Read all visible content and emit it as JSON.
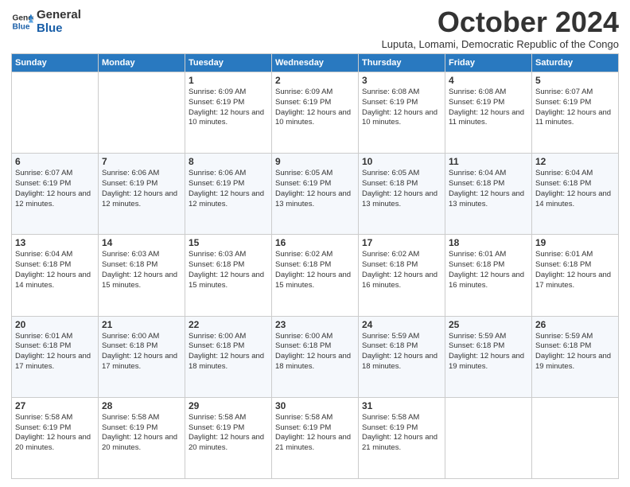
{
  "logo": {
    "line1": "General",
    "line2": "Blue"
  },
  "header": {
    "title": "October 2024",
    "subtitle": "Luputa, Lomami, Democratic Republic of the Congo"
  },
  "days_of_week": [
    "Sunday",
    "Monday",
    "Tuesday",
    "Wednesday",
    "Thursday",
    "Friday",
    "Saturday"
  ],
  "weeks": [
    [
      {
        "day": "",
        "info": ""
      },
      {
        "day": "",
        "info": ""
      },
      {
        "day": "1",
        "info": "Sunrise: 6:09 AM\nSunset: 6:19 PM\nDaylight: 12 hours\nand 10 minutes."
      },
      {
        "day": "2",
        "info": "Sunrise: 6:09 AM\nSunset: 6:19 PM\nDaylight: 12 hours\nand 10 minutes."
      },
      {
        "day": "3",
        "info": "Sunrise: 6:08 AM\nSunset: 6:19 PM\nDaylight: 12 hours\nand 10 minutes."
      },
      {
        "day": "4",
        "info": "Sunrise: 6:08 AM\nSunset: 6:19 PM\nDaylight: 12 hours\nand 11 minutes."
      },
      {
        "day": "5",
        "info": "Sunrise: 6:07 AM\nSunset: 6:19 PM\nDaylight: 12 hours\nand 11 minutes."
      }
    ],
    [
      {
        "day": "6",
        "info": "Sunrise: 6:07 AM\nSunset: 6:19 PM\nDaylight: 12 hours\nand 12 minutes."
      },
      {
        "day": "7",
        "info": "Sunrise: 6:06 AM\nSunset: 6:19 PM\nDaylight: 12 hours\nand 12 minutes."
      },
      {
        "day": "8",
        "info": "Sunrise: 6:06 AM\nSunset: 6:19 PM\nDaylight: 12 hours\nand 12 minutes."
      },
      {
        "day": "9",
        "info": "Sunrise: 6:05 AM\nSunset: 6:19 PM\nDaylight: 12 hours\nand 13 minutes."
      },
      {
        "day": "10",
        "info": "Sunrise: 6:05 AM\nSunset: 6:18 PM\nDaylight: 12 hours\nand 13 minutes."
      },
      {
        "day": "11",
        "info": "Sunrise: 6:04 AM\nSunset: 6:18 PM\nDaylight: 12 hours\nand 13 minutes."
      },
      {
        "day": "12",
        "info": "Sunrise: 6:04 AM\nSunset: 6:18 PM\nDaylight: 12 hours\nand 14 minutes."
      }
    ],
    [
      {
        "day": "13",
        "info": "Sunrise: 6:04 AM\nSunset: 6:18 PM\nDaylight: 12 hours\nand 14 minutes."
      },
      {
        "day": "14",
        "info": "Sunrise: 6:03 AM\nSunset: 6:18 PM\nDaylight: 12 hours\nand 15 minutes."
      },
      {
        "day": "15",
        "info": "Sunrise: 6:03 AM\nSunset: 6:18 PM\nDaylight: 12 hours\nand 15 minutes."
      },
      {
        "day": "16",
        "info": "Sunrise: 6:02 AM\nSunset: 6:18 PM\nDaylight: 12 hours\nand 15 minutes."
      },
      {
        "day": "17",
        "info": "Sunrise: 6:02 AM\nSunset: 6:18 PM\nDaylight: 12 hours\nand 16 minutes."
      },
      {
        "day": "18",
        "info": "Sunrise: 6:01 AM\nSunset: 6:18 PM\nDaylight: 12 hours\nand 16 minutes."
      },
      {
        "day": "19",
        "info": "Sunrise: 6:01 AM\nSunset: 6:18 PM\nDaylight: 12 hours\nand 17 minutes."
      }
    ],
    [
      {
        "day": "20",
        "info": "Sunrise: 6:01 AM\nSunset: 6:18 PM\nDaylight: 12 hours\nand 17 minutes."
      },
      {
        "day": "21",
        "info": "Sunrise: 6:00 AM\nSunset: 6:18 PM\nDaylight: 12 hours\nand 17 minutes."
      },
      {
        "day": "22",
        "info": "Sunrise: 6:00 AM\nSunset: 6:18 PM\nDaylight: 12 hours\nand 18 minutes."
      },
      {
        "day": "23",
        "info": "Sunrise: 6:00 AM\nSunset: 6:18 PM\nDaylight: 12 hours\nand 18 minutes."
      },
      {
        "day": "24",
        "info": "Sunrise: 5:59 AM\nSunset: 6:18 PM\nDaylight: 12 hours\nand 18 minutes."
      },
      {
        "day": "25",
        "info": "Sunrise: 5:59 AM\nSunset: 6:18 PM\nDaylight: 12 hours\nand 19 minutes."
      },
      {
        "day": "26",
        "info": "Sunrise: 5:59 AM\nSunset: 6:18 PM\nDaylight: 12 hours\nand 19 minutes."
      }
    ],
    [
      {
        "day": "27",
        "info": "Sunrise: 5:58 AM\nSunset: 6:19 PM\nDaylight: 12 hours\nand 20 minutes."
      },
      {
        "day": "28",
        "info": "Sunrise: 5:58 AM\nSunset: 6:19 PM\nDaylight: 12 hours\nand 20 minutes."
      },
      {
        "day": "29",
        "info": "Sunrise: 5:58 AM\nSunset: 6:19 PM\nDaylight: 12 hours\nand 20 minutes."
      },
      {
        "day": "30",
        "info": "Sunrise: 5:58 AM\nSunset: 6:19 PM\nDaylight: 12 hours\nand 21 minutes."
      },
      {
        "day": "31",
        "info": "Sunrise: 5:58 AM\nSunset: 6:19 PM\nDaylight: 12 hours\nand 21 minutes."
      },
      {
        "day": "",
        "info": ""
      },
      {
        "day": "",
        "info": ""
      }
    ]
  ]
}
